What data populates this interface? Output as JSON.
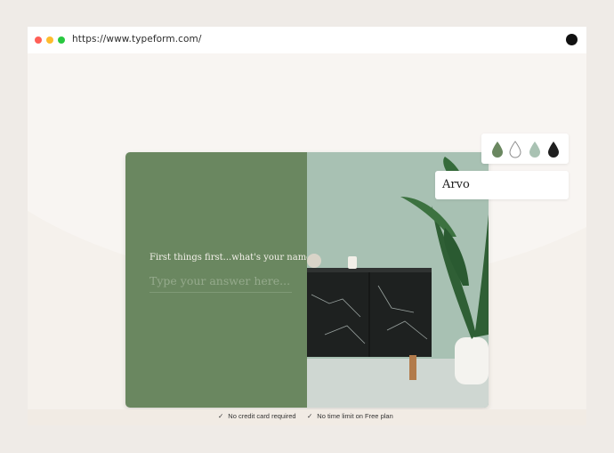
{
  "browser": {
    "url": "https://www.typeform.com/"
  },
  "form": {
    "question": "First things first...what's your name?",
    "answer_placeholder": "Type your answer here...",
    "nav": {
      "up_icon": "chevron-up-icon",
      "down_icon": "chevron-down-icon",
      "up_glyph": "⌃",
      "down_glyph": "⌄"
    },
    "colors": {
      "left_panel": "#6a8760",
      "question_text": "#f4f1ea",
      "placeholder_text": "#95aa8c"
    }
  },
  "theme_picker": {
    "swatches": [
      {
        "name": "green-drop-icon",
        "color": "#6a8760",
        "style": "filled"
      },
      {
        "name": "outline-drop-icon",
        "color": "#ffffff",
        "style": "outline"
      },
      {
        "name": "light-green-drop-icon",
        "color": "#a9c2b3",
        "style": "filled"
      },
      {
        "name": "dark-drop-icon",
        "color": "#1f1f1f",
        "style": "filled"
      }
    ],
    "font": "Arvo"
  },
  "footer": {
    "items": [
      {
        "check": "✓",
        "text": "No credit card required"
      },
      {
        "check": "✓",
        "text": "No time limit on Free plan"
      }
    ]
  }
}
